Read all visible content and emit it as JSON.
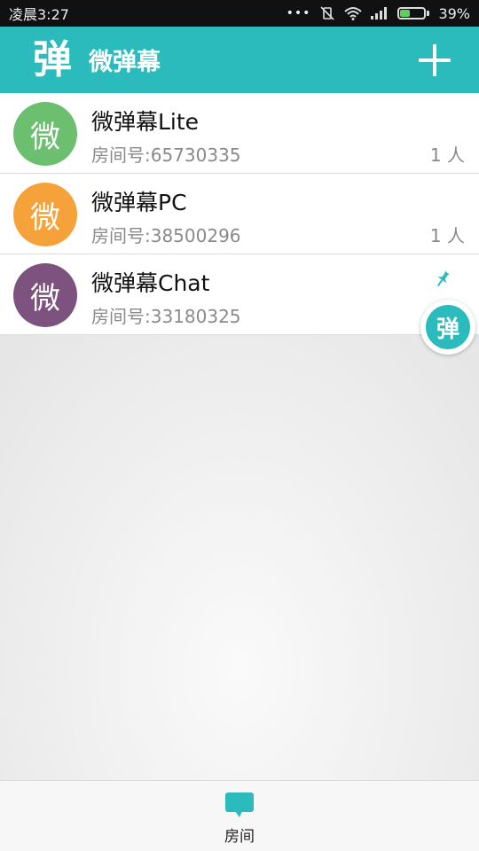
{
  "status_bar": {
    "time": "凌晨3:27",
    "dots": "•••",
    "battery": "39%",
    "battery_level": 0.39
  },
  "app_bar": {
    "logo": "弹",
    "title": "微弹幕",
    "add_icon": "plus-icon"
  },
  "rooms": [
    {
      "avatar": "微",
      "avatar_color": "#6cbf6f",
      "name": "微弹幕Lite",
      "room_id": "房间号:65730335",
      "count": "1 人"
    },
    {
      "avatar": "微",
      "avatar_color": "#f5a23a",
      "name": "微弹幕PC",
      "room_id": "房间号:38500296",
      "count": "1 人"
    },
    {
      "avatar": "微",
      "avatar_color": "#7e527e",
      "name": "微弹幕Chat",
      "room_id": "房间号:33180325",
      "pinned_icon": "pin-icon"
    }
  ],
  "floating_button": {
    "label": "弹"
  },
  "bottom_nav": {
    "tabs": [
      {
        "label": "房间",
        "icon": "chat-bubble-icon"
      }
    ]
  },
  "colors": {
    "accent": "#2cbbbd",
    "statusbar": "#111111"
  }
}
